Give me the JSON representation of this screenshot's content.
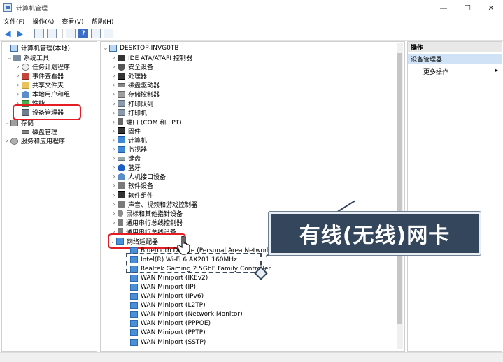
{
  "window": {
    "title": "计算机管理",
    "controls": [
      "—",
      "☐",
      "✕"
    ]
  },
  "menu": [
    "文件(F)",
    "操作(A)",
    "查看(V)",
    "帮助(H)"
  ],
  "toolbar": {
    "help_label": "?"
  },
  "left_tree": [
    {
      "label": "计算机管理(本地)",
      "icon": "computer-icon",
      "twisty": ""
    },
    {
      "label": "系统工具",
      "icon": "tools-icon",
      "twisty": "⌄"
    },
    {
      "label": "任务计划程序",
      "icon": "clock-icon",
      "twisty": "›"
    },
    {
      "label": "事件查看器",
      "icon": "event-icon",
      "twisty": "›"
    },
    {
      "label": "共享文件夹",
      "icon": "folder-icon",
      "twisty": "›"
    },
    {
      "label": "本地用户和组",
      "icon": "users-icon",
      "twisty": "›"
    },
    {
      "label": "性能",
      "icon": "performance-icon",
      "twisty": "›"
    },
    {
      "label": "设备管理器",
      "icon": "device-manager-icon",
      "twisty": ""
    },
    {
      "label": "存储",
      "icon": "storage-icon",
      "twisty": "⌄"
    },
    {
      "label": "磁盘管理",
      "icon": "disk-icon",
      "twisty": ""
    },
    {
      "label": "服务和应用程序",
      "icon": "services-icon",
      "twisty": "›"
    }
  ],
  "device_tree": {
    "root": "DESKTOP-INVG0TB",
    "categories": [
      {
        "label": "IDE ATA/ATAPI 控制器",
        "icon": "chip-icon"
      },
      {
        "label": "安全设备",
        "icon": "shield-icon"
      },
      {
        "label": "处理器",
        "icon": "chip-icon"
      },
      {
        "label": "磁盘驱动器",
        "icon": "disk-icon"
      },
      {
        "label": "存储控制器",
        "icon": "storage-icon"
      },
      {
        "label": "打印队列",
        "icon": "printer-icon"
      },
      {
        "label": "打印机",
        "icon": "printer-icon"
      },
      {
        "label": "端口 (COM 和 LPT)",
        "icon": "port-icon"
      },
      {
        "label": "固件",
        "icon": "chip-icon"
      },
      {
        "label": "计算机",
        "icon": "monitor-icon"
      },
      {
        "label": "监视器",
        "icon": "monitor-icon"
      },
      {
        "label": "键盘",
        "icon": "keyboard-icon"
      },
      {
        "label": "蓝牙",
        "icon": "bluetooth-icon"
      },
      {
        "label": "人机接口设备",
        "icon": "hid-icon"
      },
      {
        "label": "软件设备",
        "icon": "sound-icon"
      },
      {
        "label": "软件组件",
        "icon": "chip-icon"
      },
      {
        "label": "声音、视频和游戏控制器",
        "icon": "sound-icon"
      },
      {
        "label": "鼠标和其他指针设备",
        "icon": "mouse-icon"
      },
      {
        "label": "通用串行总线控制器",
        "icon": "usb-icon"
      },
      {
        "label": "通用串行总线设备",
        "icon": "usb-icon"
      }
    ],
    "network_adapters": {
      "label": "网络适配器",
      "items": [
        "Bluetooth Device (Personal Area Network)",
        "Intel(R) Wi-Fi 6 AX201 160MHz",
        "Realtek Gaming 2.5GbE Family Controller",
        "WAN Miniport (IKEv2)",
        "WAN Miniport (IP)",
        "WAN Miniport (IPv6)",
        "WAN Miniport (L2TP)",
        "WAN Miniport (Network Monitor)",
        "WAN Miniport (PPPOE)",
        "WAN Miniport (PPTP)",
        "WAN Miniport (SSTP)"
      ]
    }
  },
  "actions": {
    "header": "操作",
    "section": "设备管理器",
    "more": "更多操作",
    "more_arrow": "▸"
  },
  "overlay": {
    "caption": "有线(无线)网卡"
  }
}
